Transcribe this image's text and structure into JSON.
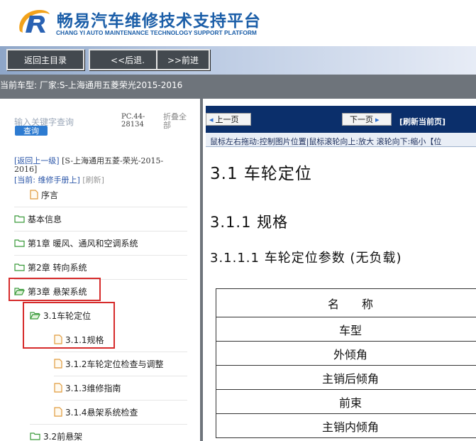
{
  "header": {
    "title": "畅易汽车维修技术支持平台",
    "subtitle": "CHANG YI AUTO MAINTENANCE TECHNOLOGY SUPPORT PLATFORM",
    "brand_color": "#1b5ea8",
    "logo_icon": "r-swoosh-logo-icon"
  },
  "nav": {
    "home": "返回主目录",
    "back": "<<后退.",
    "forward": ">>前进"
  },
  "vehicle_bar": {
    "text": "当前车型:  厂家:S-上海通用五菱荣光2015-2016"
  },
  "sidebar": {
    "search_placeholder": "输入关键字查询",
    "search_button": "查询",
    "pc_code": "PC.44-28134",
    "collapse_all": "折叠全部",
    "crumb_up": "[返回上一级]",
    "crumb_path": "[S-上海通用五菱-荣光-2015-2016]",
    "crumb_current": "[当前: 维修手册上]",
    "crumb_refresh": "[刷新]",
    "items": [
      {
        "label": "序言",
        "icon": "document-icon"
      },
      {
        "label": "基本信息",
        "icon": "folder-icon"
      },
      {
        "label": "第1章 暖风、通风和空调系统",
        "icon": "folder-icon"
      },
      {
        "label": "第2章 转向系统",
        "icon": "folder-icon"
      },
      {
        "label": "第3章 悬架系统",
        "icon": "folder-open-icon"
      },
      {
        "label": "3.1车轮定位",
        "icon": "folder-open-icon"
      },
      {
        "label": "3.1.1规格",
        "icon": "document-icon"
      },
      {
        "label": "3.1.2车轮定位检查与调整",
        "icon": "document-icon"
      },
      {
        "label": "3.1.3维修指南",
        "icon": "document-icon"
      },
      {
        "label": "3.1.4悬架系统检查",
        "icon": "document-icon"
      },
      {
        "label": "3.2前悬架",
        "icon": "folder-icon"
      }
    ],
    "highlight_color": "#d62b2b"
  },
  "viewer": {
    "prev": "上一页",
    "next": "下一页",
    "refresh": "[刷新当前页]",
    "hint": "鼠标左右拖动:控制图片位置|鼠标滚轮向上:放大  滚轮向下:缩小【位",
    "h1": "3.1  车轮定位",
    "h2": "3.1.1  规格",
    "h3": "3.1.1.1  车轮定位参数  (无负载)",
    "table_rows": [
      "名　　称",
      "车型",
      "外倾角",
      "主销后倾角",
      "前束",
      "主销内倾角"
    ],
    "toolbar_color": "#0b2f6b"
  }
}
